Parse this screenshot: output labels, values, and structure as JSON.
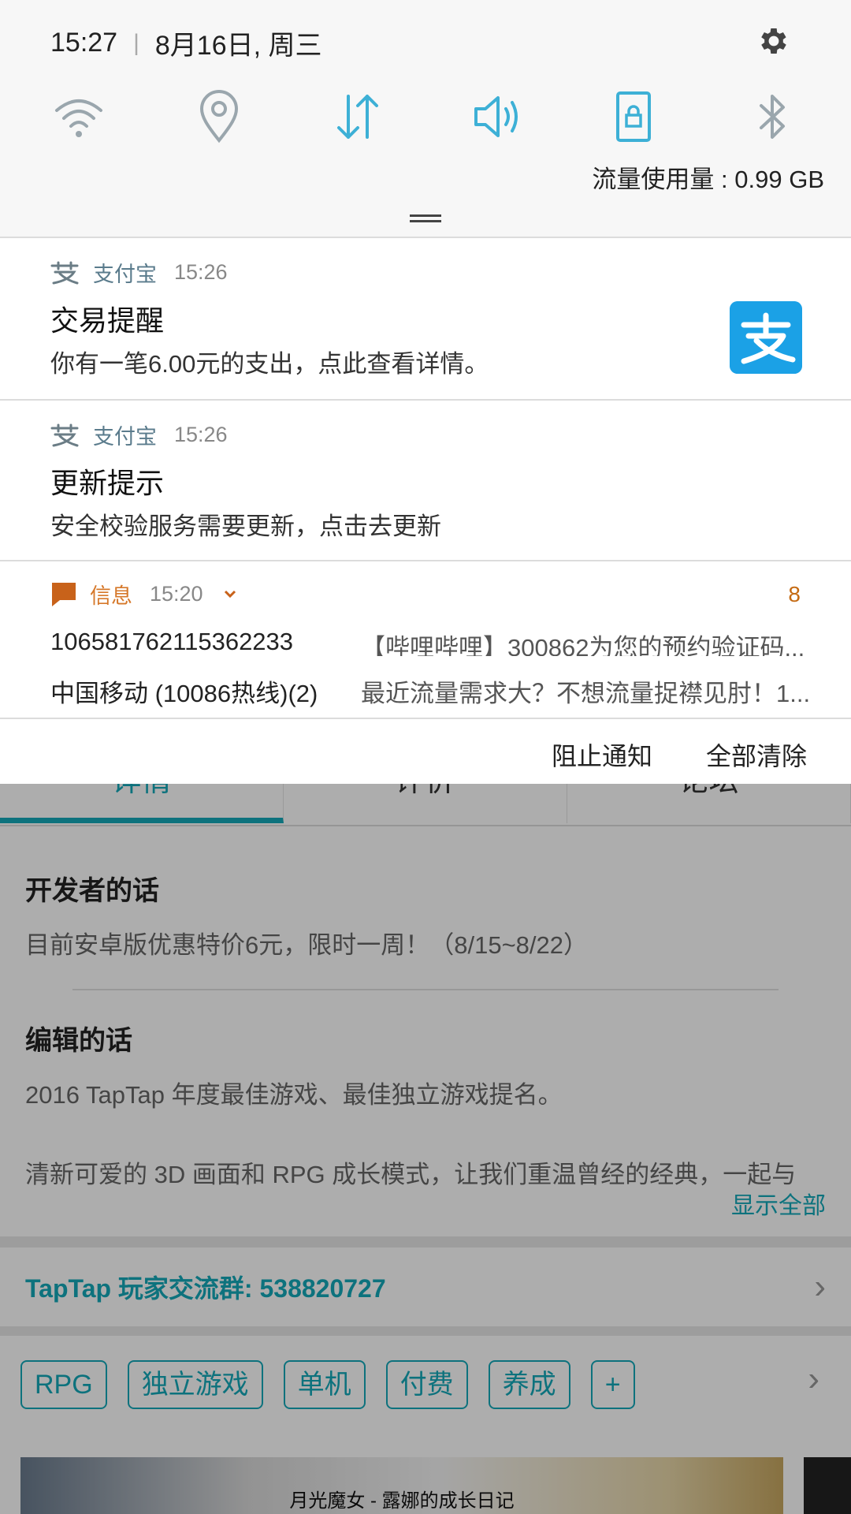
{
  "status_bar": {
    "time": "15:27",
    "date": "8月16日, 周三",
    "settings_icon": "gear-icon"
  },
  "quick_settings": {
    "icons": [
      "wifi-icon",
      "location-icon",
      "data-transfer-icon",
      "sound-icon",
      "rotation-lock-icon",
      "bluetooth-icon"
    ],
    "active_color": "#3db0d6",
    "inactive_color": "#9aa6ad",
    "data_usage": "流量使用量 : 0.99 GB"
  },
  "notifications": [
    {
      "app": "支付宝",
      "time": "15:26",
      "title": "交易提醒",
      "body": "你有一笔6.00元的支出，点此查看详情。"
    },
    {
      "app": "支付宝",
      "time": "15:26",
      "title": "更新提示",
      "body": "安全校验服务需要更新，点击去更新"
    }
  ],
  "messages": {
    "app": "信息",
    "time": "15:20",
    "count": "8",
    "rows": [
      {
        "sender": "106581762115362233",
        "preview": "【哔哩哔哩】300862为您的预约验证码..."
      },
      {
        "sender": "中国移动 (10086热线)(2)",
        "preview": "最近流量需求大？不想流量捉襟见肘！1..."
      }
    ]
  },
  "shade_actions": {
    "block": "阻止通知",
    "clear_all": "全部清除"
  },
  "background_app": {
    "tabs": [
      "详情",
      "评价",
      "论坛"
    ],
    "developer_title": "开发者的话",
    "developer_text": "目前安卓版优惠特价6元，限时一周！（8/15~8/22）",
    "editor_title": "编辑的话",
    "editor_line1": "2016 TapTap 年度最佳游戏、最佳独立游戏提名。",
    "editor_line2": "清新可爱的 3D 画面和 RPG 成长模式，让我们重温曾经的经典，一起与",
    "show_all": "显示全部",
    "group": "TapTap 玩家交流群:  538820727",
    "tags": [
      "RPG",
      "独立游戏",
      "单机",
      "付费",
      "养成",
      "+"
    ],
    "banner_caption": "月光魔女 - 露娜的成长日记",
    "accent_color": "#14a9b9"
  }
}
